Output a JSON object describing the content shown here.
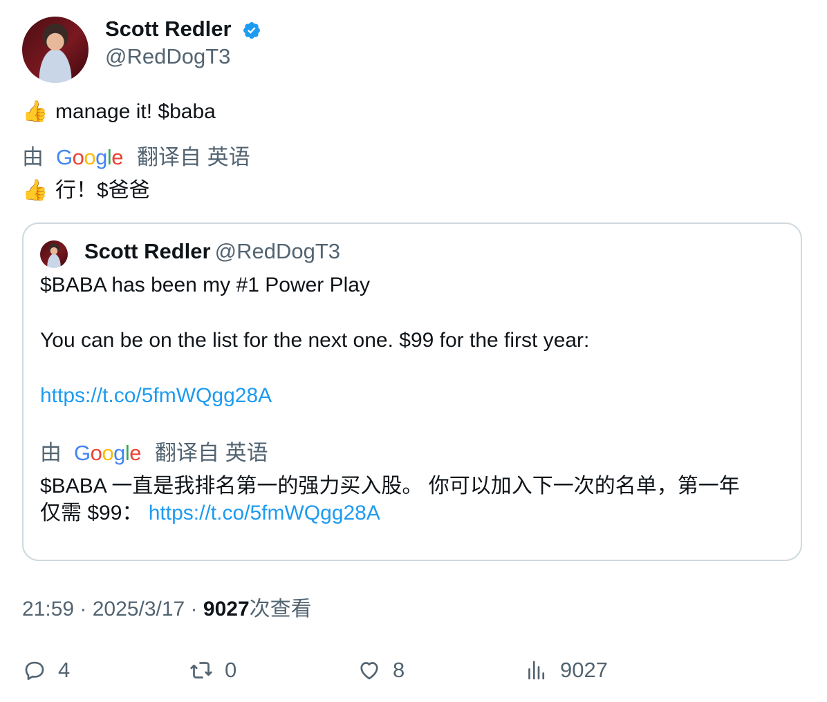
{
  "author": {
    "name": "Scott Redler",
    "handle": "@RedDogT3",
    "verified": true
  },
  "post": {
    "emoji": "👍",
    "text": "manage it! $baba",
    "translation_prefix": "由",
    "translation_suffix": "翻译自 英语",
    "translated_text": "行！$爸爸"
  },
  "quoted": {
    "name": "Scott Redler",
    "handle": "@RedDogT3",
    "line1": "$BABA has been my #1 Power Play",
    "line2": "You can be on the list for the next one. $99 for the first year:",
    "link": "https://t.co/5fmWQgg28A",
    "translation_prefix": "由",
    "translation_suffix": "翻译自 英语",
    "translated_line1": "$BABA 一直是我排名第一的强力买入股。 你可以加入下一次的名单，第一年",
    "translated_line2_prefix": "仅需 $99：",
    "translated_link": "https://t.co/5fmWQgg28A"
  },
  "meta": {
    "time": "21:59",
    "date": "2025/3/17",
    "views_count": "9027",
    "views_label": "次查看"
  },
  "actions": {
    "replies": "4",
    "reposts": "0",
    "likes": "8",
    "views": "9027"
  },
  "colors": {
    "accent": "#1d9bf0",
    "muted": "#536471",
    "border": "#cfd9de"
  }
}
